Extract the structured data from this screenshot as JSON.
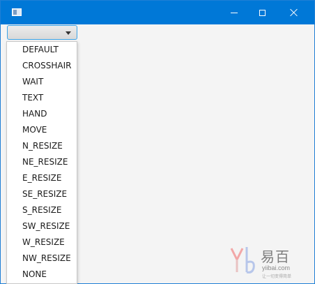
{
  "window": {
    "title": "",
    "controls": {
      "minimize_icon": "minimize-icon",
      "maximize_icon": "maximize-icon",
      "close_icon": "close-icon"
    }
  },
  "combo": {
    "selected_value": "",
    "arrow_icon": "chevron-down-icon"
  },
  "dropdown": {
    "options": [
      "DEFAULT",
      "CROSSHAIR",
      "WAIT",
      "TEXT",
      "HAND",
      "MOVE",
      "N_RESIZE",
      "NE_RESIZE",
      "E_RESIZE",
      "SE_RESIZE",
      "S_RESIZE",
      "SW_RESIZE",
      "W_RESIZE",
      "NW_RESIZE",
      "NONE"
    ]
  },
  "watermark": {
    "brand": "易百",
    "url": "yiibai.com",
    "tagline": "让一切变得简单"
  },
  "colors": {
    "titlebar": "#0078d7",
    "window_bg": "#f4f4f4",
    "accent_border": "#3aa3e8"
  }
}
